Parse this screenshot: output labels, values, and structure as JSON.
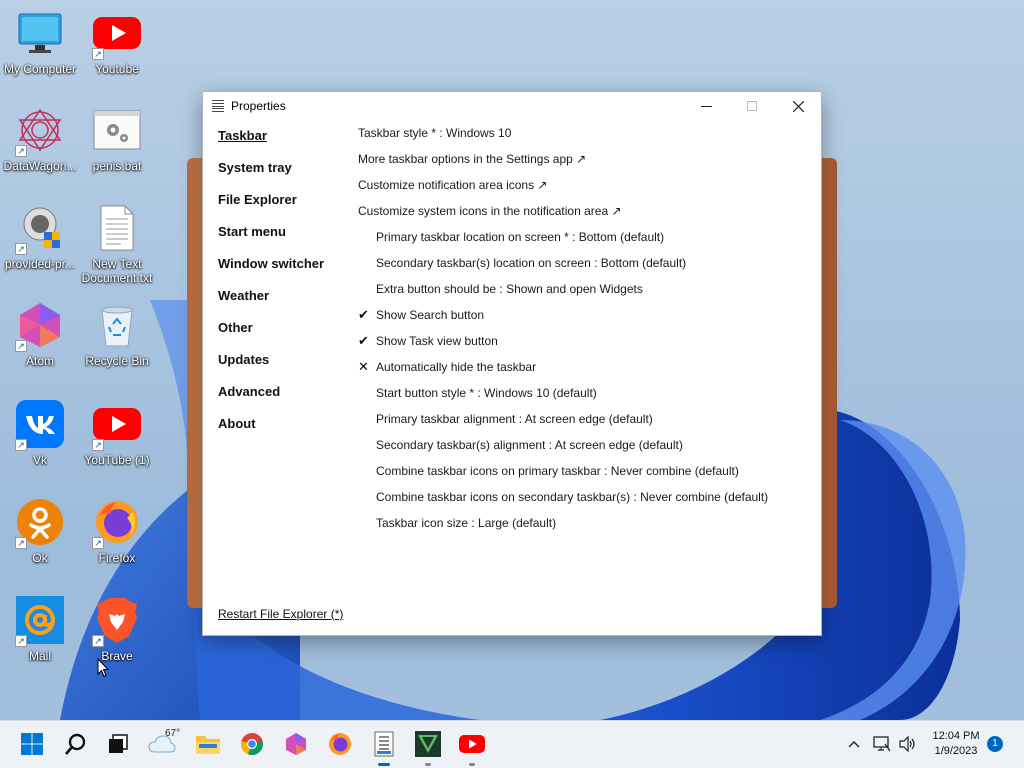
{
  "desktop": {
    "icons": [
      {
        "label": "My Computer"
      },
      {
        "label": "Youtube"
      },
      {
        "label": "DataWagon..."
      },
      {
        "label": "penis.bat"
      },
      {
        "label": "provided-pr..."
      },
      {
        "label": "New Text Document.txt"
      },
      {
        "label": "Atom"
      },
      {
        "label": "Recycle Bin"
      },
      {
        "label": "Vk"
      },
      {
        "label": "YouTube (1)"
      },
      {
        "label": "Ok"
      },
      {
        "label": "Firefox"
      },
      {
        "label": "Mail"
      },
      {
        "label": "Brave"
      }
    ]
  },
  "window": {
    "title": "Properties",
    "nav": [
      "Taskbar",
      "System tray",
      "File Explorer",
      "Start menu",
      "Window switcher",
      "Weather",
      "Other",
      "Updates",
      "Advanced",
      "About"
    ],
    "options": [
      {
        "text": "Taskbar style * : Windows 10",
        "mark": ""
      },
      {
        "text": "More taskbar options in the Settings app ↗",
        "mark": ""
      },
      {
        "text": "Customize notification area icons ↗",
        "mark": ""
      },
      {
        "text": "Customize system icons in the notification area ↗",
        "mark": ""
      },
      {
        "text": "Primary taskbar location on screen * : Bottom (default)",
        "mark": ""
      },
      {
        "text": "Secondary taskbar(s) location on screen : Bottom (default)",
        "mark": ""
      },
      {
        "text": "Extra button should be : Shown and open Widgets",
        "mark": ""
      },
      {
        "text": "Show Search button",
        "mark": "✔"
      },
      {
        "text": "Show Task view button",
        "mark": "✔"
      },
      {
        "text": "Automatically hide the taskbar",
        "mark": "✕"
      },
      {
        "text": "Start button style * : Windows 10 (default)",
        "mark": ""
      },
      {
        "text": "Primary taskbar alignment : At screen edge (default)",
        "mark": ""
      },
      {
        "text": "Secondary taskbar(s) alignment : At screen edge (default)",
        "mark": ""
      },
      {
        "text": "Combine taskbar icons on primary taskbar : Never combine (default)",
        "mark": ""
      },
      {
        "text": "Combine taskbar icons on secondary taskbar(s) : Never combine (default)",
        "mark": ""
      },
      {
        "text": "Taskbar icon size : Large (default)",
        "mark": ""
      }
    ],
    "restart_link": "Restart File Explorer (*)"
  },
  "taskbar": {
    "weather_temp": "67°",
    "time": "12:04 PM",
    "date": "1/9/2023",
    "notification_count": "1"
  },
  "colors": {
    "accent": "#0067c0",
    "youtube": "#ff0000",
    "vk": "#0077ff",
    "ok": "#ee8208",
    "mail": "#168de2"
  }
}
